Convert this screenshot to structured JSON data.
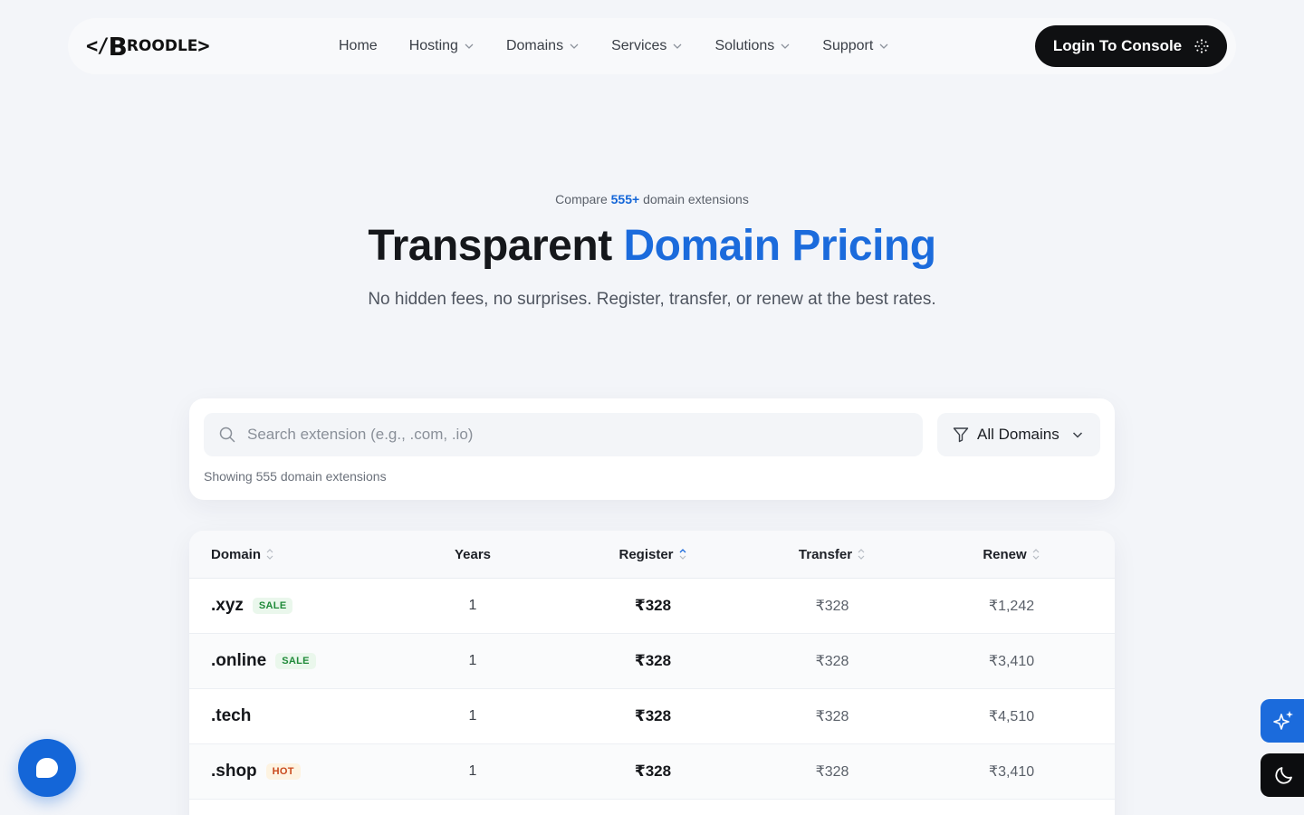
{
  "brand": {
    "logo_prefix": "</",
    "logo_big": "B",
    "logo_rest": "ROODLE",
    "logo_suffix": ">"
  },
  "nav": {
    "items": [
      {
        "label": "Home",
        "has_dropdown": false
      },
      {
        "label": "Hosting",
        "has_dropdown": true
      },
      {
        "label": "Domains",
        "has_dropdown": true
      },
      {
        "label": "Services",
        "has_dropdown": true
      },
      {
        "label": "Solutions",
        "has_dropdown": true
      },
      {
        "label": "Support",
        "has_dropdown": true
      }
    ],
    "login_label": "Login To Console"
  },
  "hero": {
    "kicker_before": "Compare ",
    "kicker_count": "555+",
    "kicker_after": " domain extensions",
    "title_plain": "Transparent ",
    "title_accent": "Domain Pricing",
    "subtitle": "No hidden fees, no surprises. Register, transfer, or renew at the best rates."
  },
  "search": {
    "placeholder": "Search extension (e.g., .com, .io)",
    "value": "",
    "filter_label": "All Domains",
    "showing_text": "Showing 555 domain extensions"
  },
  "table": {
    "headers": {
      "domain": "Domain",
      "years": "Years",
      "register": "Register",
      "transfer": "Transfer",
      "renew": "Renew"
    },
    "rows": [
      {
        "ext": ".xyz",
        "badge": "SALE",
        "badge_type": "sale",
        "years": "1",
        "register": "₹328",
        "transfer": "₹328",
        "renew": "₹1,242"
      },
      {
        "ext": ".online",
        "badge": "SALE",
        "badge_type": "sale",
        "years": "1",
        "register": "₹328",
        "transfer": "₹328",
        "renew": "₹3,410"
      },
      {
        "ext": ".tech",
        "badge": "",
        "badge_type": "",
        "years": "1",
        "register": "₹328",
        "transfer": "₹328",
        "renew": "₹4,510"
      },
      {
        "ext": ".shop",
        "badge": "HOT",
        "badge_type": "hot",
        "years": "1",
        "register": "₹328",
        "transfer": "₹328",
        "renew": "₹3,410"
      }
    ]
  },
  "colors": {
    "accent": "#1b6bdc",
    "dark": "#0f1012",
    "background": "#f3f5f9"
  },
  "icons": [
    "chevron-down-icon",
    "sparkle-icon",
    "search-icon",
    "filter-icon",
    "sort-icon",
    "chat-icon",
    "ai-sparkles-icon",
    "moon-icon"
  ]
}
